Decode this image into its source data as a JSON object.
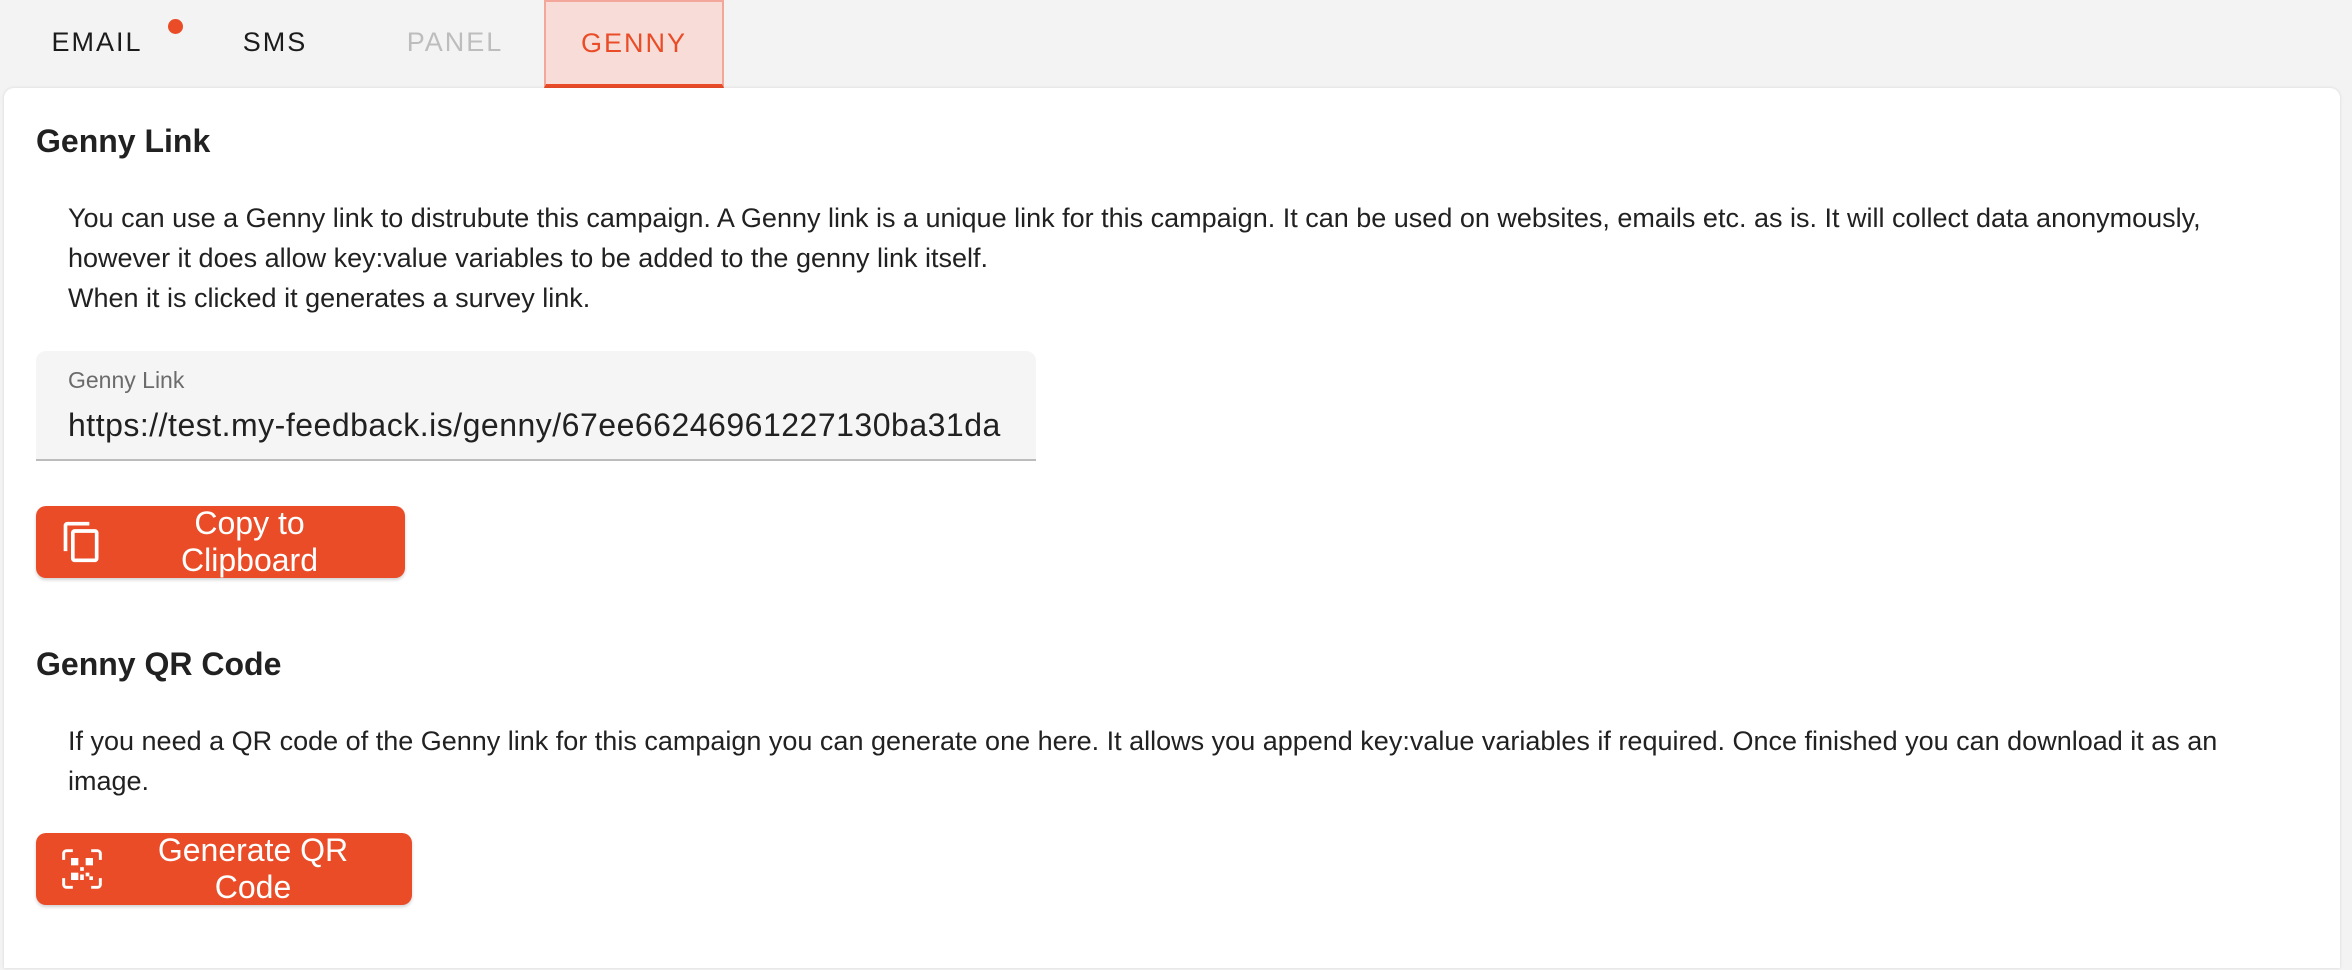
{
  "tabs": [
    {
      "label": "EMAIL",
      "state": "default",
      "has_notification": true
    },
    {
      "label": "SMS",
      "state": "default"
    },
    {
      "label": "PANEL",
      "state": "disabled"
    },
    {
      "label": "GENNY",
      "state": "active"
    }
  ],
  "genny_link": {
    "heading": "Genny Link",
    "description_line1": "You can use a Genny link to distrubute this campaign. A Genny link is a unique link for this campaign. It can be used on websites, emails etc. as is. It will collect data anonymously, however it does allow key:value variables to be added to the genny link itself.",
    "description_line2": "When it is clicked it generates a survey link.",
    "field_label": "Genny Link",
    "field_value": "https://test.my-feedback.is/genny/67ee66246961227130ba31da",
    "copy_button_label": "Copy to Clipboard",
    "copy_icon": "content-copy-icon"
  },
  "genny_qr": {
    "heading": "Genny QR Code",
    "description": "If you need a QR code of the Genny link for this campaign you can generate one here. It allows you append key:value variables if required. Once finished you can download it as an image.",
    "generate_button_label": "Generate QR Code",
    "qr_icon": "qr-code-scan-icon"
  },
  "colors": {
    "accent": "#ea4c28",
    "active_tab_bg": "#f8dcd7",
    "disabled_tab_text": "#bdbdbd"
  }
}
